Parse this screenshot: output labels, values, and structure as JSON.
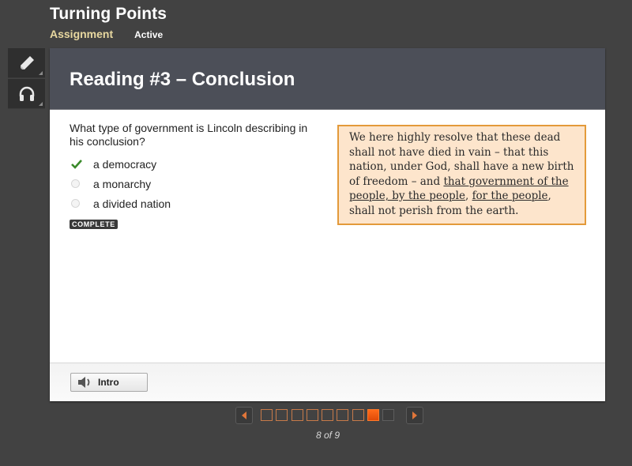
{
  "header": {
    "app_title": "Turning Points",
    "assignment_label": "Assignment",
    "status_label": "Active"
  },
  "tools": [
    {
      "name": "pencil-icon",
      "label": "Annotate"
    },
    {
      "name": "headphones-icon",
      "label": "Audio"
    }
  ],
  "lesson": {
    "title": "Reading #3 – Conclusion",
    "question": "What type of government is Lincoln describing in his conclusion?",
    "options": [
      {
        "label": "a democracy",
        "state": "correct"
      },
      {
        "label": "a monarchy",
        "state": "unselected"
      },
      {
        "label": "a divided nation",
        "state": "unselected"
      }
    ],
    "badge": "COMPLETE",
    "quote": {
      "part1": "We here highly resolve that these dead shall not have died in vain – that this nation, under God, shall have a new birth of freedom – and ",
      "underlined1": "that government of the people, by the people",
      "comma": ", ",
      "underlined2": "for the people",
      "part2": ", shall not perish from the earth."
    }
  },
  "footer": {
    "intro_button": "Intro"
  },
  "pager": {
    "current": 8,
    "total": 9,
    "label": "8 of 9",
    "accent_color": "#f05a10"
  }
}
